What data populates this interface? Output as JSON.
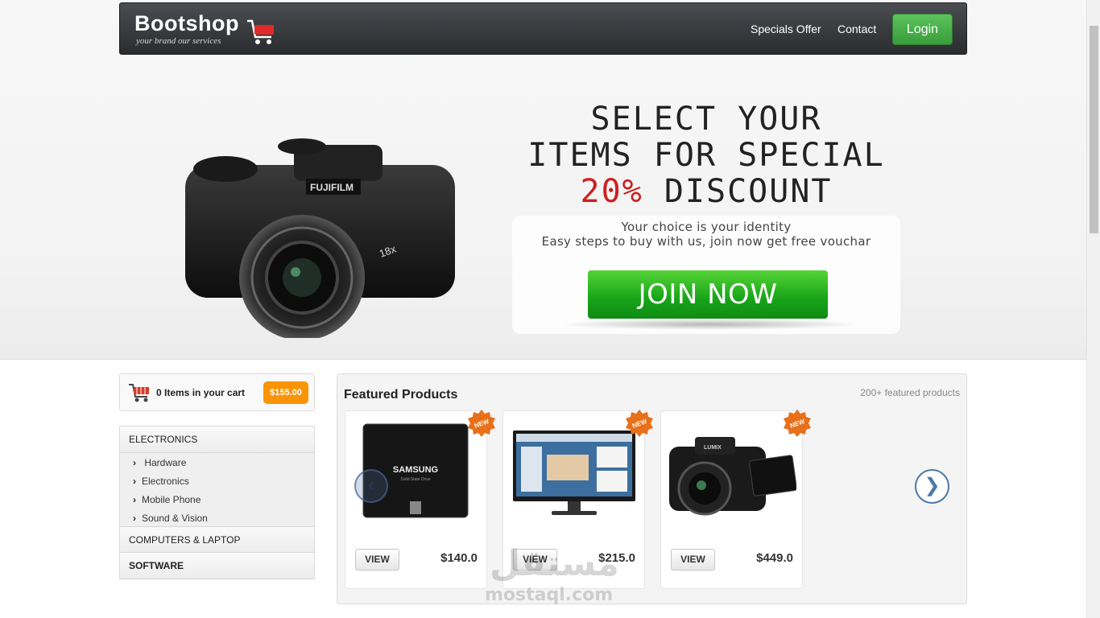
{
  "navbar": {
    "brand_name": "Bootshop",
    "brand_tagline": "your brand our services",
    "links": [
      "Specials Offer",
      "Contact"
    ],
    "login_label": "Login"
  },
  "hero": {
    "headline_line1": "SELECT YOUR",
    "headline_line2": "ITEMS FOR SPECIAL",
    "headline_percent": "20%",
    "headline_word": "DISCOUNT",
    "subtext_line1": "Your choice is your identity",
    "subtext_line2": "Easy steps to buy with us, join now get free vouchar",
    "join_label": "JOIN NOW",
    "camera_brand_text": "FUJIFILM",
    "camera_zoom_text": "18x"
  },
  "cart": {
    "text": "0 Items in your cart",
    "total": "$155.00"
  },
  "sidebar": {
    "categories": [
      {
        "label": "ELECTRONICS",
        "items": [
          "Hardware",
          "Electronics",
          "Mobile Phone",
          "Sound & Vision"
        ]
      },
      {
        "label": "COMPUTERS & LAPTOP",
        "items": []
      },
      {
        "label": "SOFTWARE",
        "items": []
      }
    ]
  },
  "featured": {
    "title": "Featured Products",
    "count_text": "200+ featured products",
    "badge_text": "NEW",
    "products": [
      {
        "view_label": "VIEW",
        "price": "$140.0",
        "image_text": "SAMSUNG",
        "image_subtext": "Solid State Drive"
      },
      {
        "view_label": "VIEW",
        "price": "$215.0"
      },
      {
        "view_label": "VIEW",
        "price": "$449.0",
        "image_text": "LUMIX"
      }
    ]
  },
  "carousel": {
    "prev_glyph": "‹",
    "next_glyph": "❯"
  },
  "watermark": {
    "arabic": "مستقل",
    "latin": "mostaql.com"
  },
  "colors": {
    "navbar": "#3a3c40",
    "login_green": "#4cb04d",
    "join_green": "#1aa61b",
    "discount_red": "#cc1f1f",
    "cart_badge_orange": "#f89406",
    "new_badge_orange": "#e8701a",
    "carousel_blue": "#4d79a8"
  }
}
